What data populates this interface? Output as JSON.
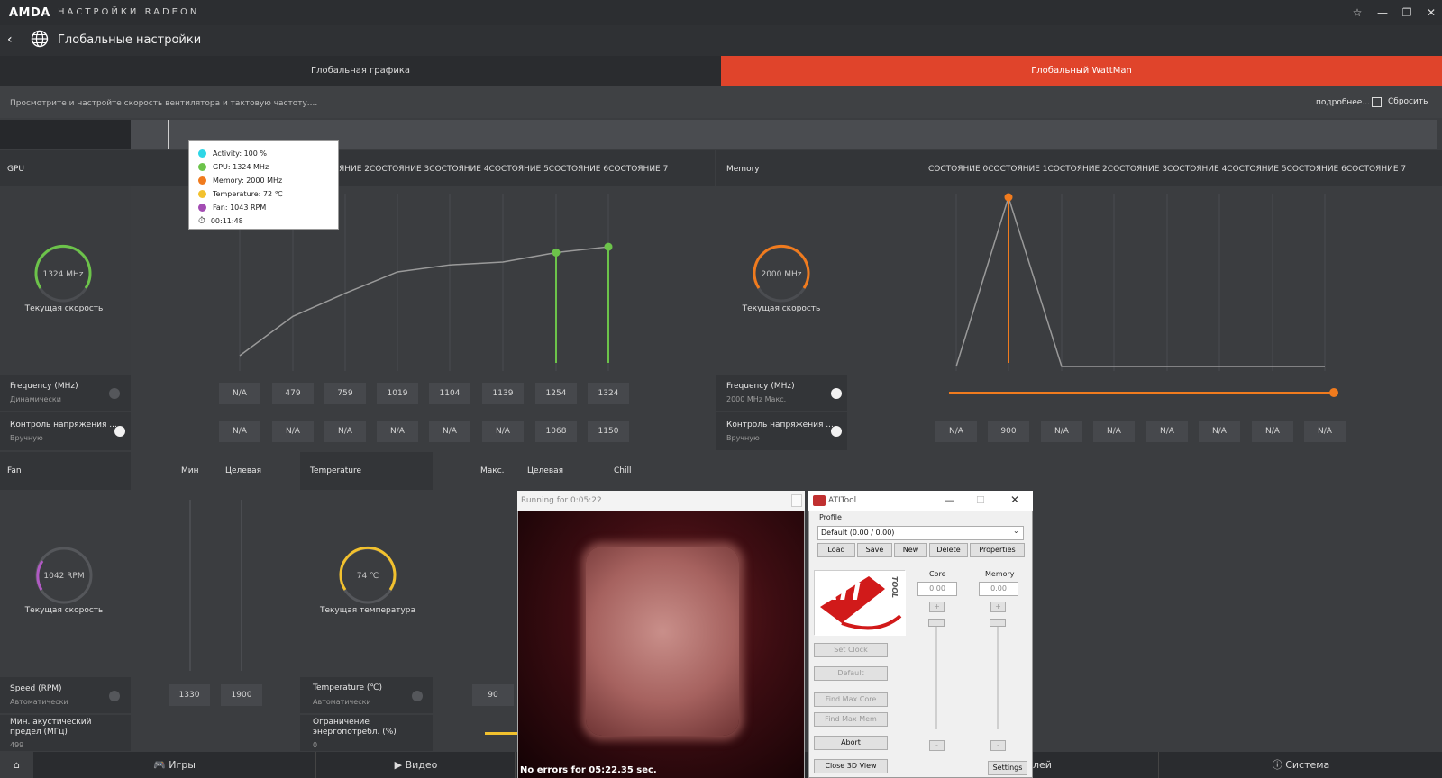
{
  "window": {
    "brand": "AMDA",
    "app_title": "НАСТРОЙКИ RADEON",
    "page_title": "Глобальные настройки"
  },
  "tabs": [
    {
      "label": "Глобальная графика",
      "active": false
    },
    {
      "label": "Глобальный WattMan",
      "active": true
    }
  ],
  "description": "Просмотрите и настройте скорость вентилятора и тактовую частоту....",
  "links": {
    "more": "подробнее...",
    "reset": "Сбросить"
  },
  "tooltip": {
    "rows": [
      {
        "color": "#2ed6e6",
        "text": "Activity: 100 %"
      },
      {
        "color": "#6cc34a",
        "text": "GPU: 1324 MHz"
      },
      {
        "color": "#f07b1e",
        "text": "Memory: 2000 MHz"
      },
      {
        "color": "#f2c12e",
        "text": "Temperature: 72 ℃"
      },
      {
        "color": "#a34cb3",
        "text": "Fan: 1043 RPM"
      }
    ],
    "timer": "00:11:48"
  },
  "gpu": {
    "section": "GPU",
    "state_labels": "ЯНИЕ 2СОСТОЯНИЕ 3СОСТОЯНИЕ 4СОСТОЯНИЕ 5СОСТОЯНИЕ 6СОСТОЯНИЕ 7",
    "gauge_value": "1324 MHz",
    "gauge_label": "Текущая скорость",
    "freq_label": "Frequency (MHz)",
    "freq_sub": "Динамически",
    "volt_label": "Контроль напряжения ...",
    "volt_sub": "Вручную",
    "freq_values": [
      "N/A",
      "479",
      "759",
      "1019",
      "1104",
      "1139",
      "1254",
      "1324"
    ],
    "volt_values": [
      "N/A",
      "N/A",
      "N/A",
      "N/A",
      "N/A",
      "N/A",
      "1068",
      "1150"
    ],
    "curve": [
      0,
      479,
      759,
      1019,
      1104,
      1139,
      1254,
      1324
    ]
  },
  "memory": {
    "section": "Memory",
    "state_labels": "СОСТОЯНИЕ 0СОСТОЯНИЕ 1СОСТОЯНИЕ 2СОСТОЯНИЕ 3СОСТОЯНИЕ 4СОСТОЯНИЕ 5СОСТОЯНИЕ 6СОСТОЯНИЕ 7",
    "gauge_value": "2000 MHz",
    "gauge_label": "Текущая скорость",
    "freq_label": "Frequency (MHz)",
    "freq_sub": "2000 MHz Макс.",
    "volt_label": "Контроль напряжения ...",
    "volt_sub": "Вручную",
    "volt_values": [
      "N/A",
      "900",
      "N/A",
      "N/A",
      "N/A",
      "N/A",
      "N/A",
      "N/A"
    ]
  },
  "fan": {
    "section": "Fan",
    "col_min": "Мин",
    "col_target": "Целевая",
    "gauge_value": "1042 RPM",
    "gauge_label": "Текущая скорость",
    "speed_label": "Speed (RPM)",
    "speed_sub": "Автоматически",
    "min_value": "1330",
    "target_value": "1900",
    "acoustic_label": "Мин. акустический предел (МГц)",
    "acoustic_sub": "499"
  },
  "temperature": {
    "section": "Temperature",
    "col_max": "Макс.",
    "col_target": "Целевая",
    "col_chill": "Chill",
    "gauge_value": "74 ℃",
    "gauge_label": "Текущая температура",
    "temp_label": "Temperature (℃)",
    "temp_sub": "Автоматически",
    "max_value": "90",
    "power_label": "Ограничение энергопотребл. (%)",
    "power_sub": "0"
  },
  "bottom_nav": [
    {
      "label": "Игры",
      "icon": "gamepad-icon"
    },
    {
      "label": "Видео",
      "icon": "play-icon"
    },
    {
      "label": "лей",
      "icon": ""
    },
    {
      "label": "Система",
      "icon": "info-icon"
    }
  ],
  "run_window": {
    "title": "Running for 0:05:22",
    "status": "No errors for 05:22.35 sec."
  },
  "atitool": {
    "title": "ATITool",
    "profile_label": "Profile",
    "profile_value": "Default (0.00 / 0.00)",
    "buttons": [
      "Load",
      "Save",
      "New",
      "Delete",
      "Properties"
    ],
    "core_label": "Core",
    "memory_label": "Memory",
    "core_value": "0.00",
    "memory_value": "0.00",
    "logo_text": "ATI",
    "logo_sub": "TOOL",
    "action_buttons": [
      "Set Clock",
      "Default",
      "Find Max Core",
      "Find Max Mem",
      "Abort",
      "Close 3D View"
    ],
    "settings": "Settings"
  },
  "colors": {
    "accent_red": "#e0442b",
    "gpu_green": "#6cc34a",
    "mem_orange": "#f07b1e",
    "fan_purple": "#b05ac3",
    "temp_yellow": "#f2c12e"
  }
}
